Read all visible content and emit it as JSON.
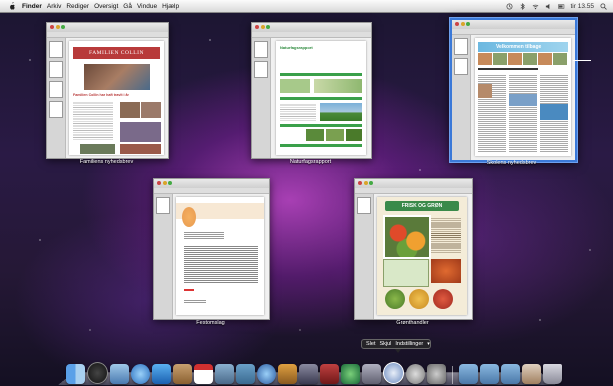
{
  "menubar": {
    "app_name": "Finder",
    "items": [
      "Arkiv",
      "Rediger",
      "Oversigt",
      "Gå",
      "Vindue",
      "Hjælp"
    ],
    "clock": "tir 13.55"
  },
  "windows": [
    {
      "label": "Familiens nyhedsbrev",
      "heading": "FAMILIEN COLLIN",
      "subheading": "Familien Collin har haft travlt i år"
    },
    {
      "label": "Naturfagsrapport",
      "heading": "Naturfagsrapport"
    },
    {
      "label": "Skolens nyhedsbrev",
      "heading": "Velkommen tilbage"
    },
    {
      "label": "Festomslag"
    },
    {
      "label": "Grønthandler",
      "heading": "FRISK OG GRØN"
    }
  ],
  "dock_popup": {
    "items": [
      "Slet",
      "Skjul",
      "Indstillinger"
    ]
  },
  "dock_icons": [
    "finder-icon",
    "dashboard-icon",
    "mail-icon",
    "safari-icon",
    "ichat-icon",
    "address-book-icon",
    "ical-icon",
    "preview-icon",
    "iphoto-icon",
    "itunes-icon",
    "garageband-icon",
    "imovie-icon",
    "photo-booth-icon",
    "time-machine-icon",
    "xcode-icon",
    "pages-icon",
    "dvd-icon",
    "system-preferences-icon",
    "applications-folder-icon",
    "documents-folder-icon",
    "downloads-folder-icon",
    "stack-icon",
    "trash-icon"
  ]
}
